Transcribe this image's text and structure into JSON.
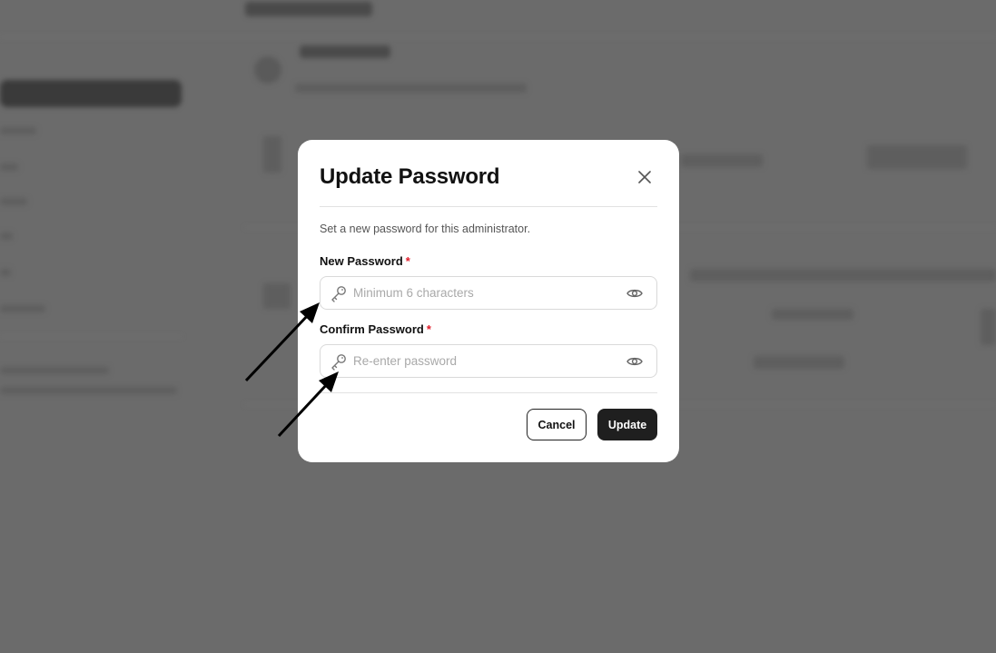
{
  "dialog": {
    "title": "Update Password",
    "description": "Set a new password for this administrator.",
    "new_password": {
      "label": "New Password",
      "required_mark": "*",
      "placeholder": "Minimum 6 characters",
      "value": ""
    },
    "confirm_password": {
      "label": "Confirm Password",
      "required_mark": "*",
      "placeholder": "Re-enter password",
      "value": ""
    },
    "cancel_label": "Cancel",
    "update_label": "Update"
  },
  "icons": {
    "close": "close-icon",
    "key": "key-icon",
    "eye": "eye-icon"
  },
  "colors": {
    "overlay": "#6b6b6b",
    "primary_button": "#1f1f1f",
    "required": "#e11d2a"
  }
}
